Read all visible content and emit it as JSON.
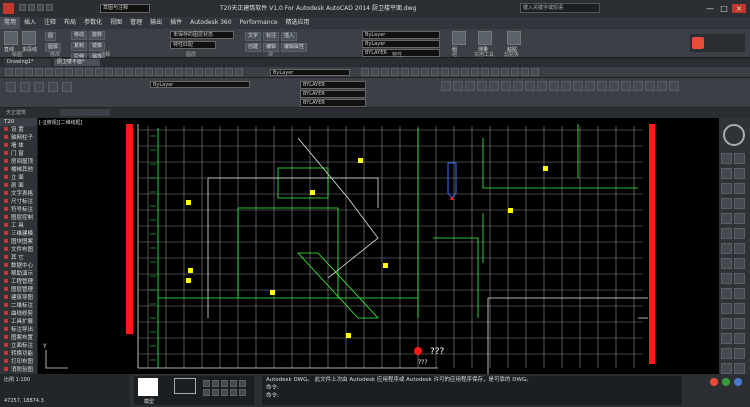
{
  "title": {
    "quick_panel": "草图与注释",
    "window_title": "T20天正建筑软件 V1.0 For Autodesk AutoCAD 2014",
    "file_name": "厨卫楼平面.dwg",
    "search_placeholder": "键入关键字或短语"
  },
  "menu": [
    "常用",
    "插入",
    "注释",
    "布局",
    "参数化",
    "视图",
    "管理",
    "输出",
    "插件",
    "Autodesk 360",
    "Performance",
    "精选应用"
  ],
  "ribbon_groups": [
    "绘图",
    "修改",
    "注释",
    "图层",
    "块",
    "特性",
    "组",
    "实用工具",
    "剪贴板"
  ],
  "ribbon_tools": {
    "line": "直线",
    "polyline": "多段线",
    "circle": "圆",
    "arc": "圆弧",
    "move": "移动",
    "copy": "复制",
    "stretch": "拉伸",
    "rotate": "旋转",
    "mirror": "镜像",
    "scale": "缩放",
    "text": "文字",
    "mark": "标注",
    "insert": "插入",
    "create": "创建",
    "edit": "编辑",
    "edit_attr": "编辑属性",
    "layer_current": "未保存的图层状态",
    "match_attr": "特性匹配",
    "layer_value": "ByLayer",
    "linetype_value": "ByLayer",
    "lineweight_value": "BYLAYER",
    "group": "组",
    "measure": "测量",
    "paste": "粘贴"
  },
  "doc_tabs": [
    "Drawing1*",
    "厨卫楼平面*"
  ],
  "toolbar": {
    "layer_label": "ByLayer",
    "linetype_1": "BYLAYER",
    "linetype_2": "BYLAYER",
    "linetype_3": "BYLAYER",
    "bylayer_right": "ByColor"
  },
  "tianzheng_panel": {
    "header": "T20",
    "subheader": "天正建筑",
    "items": [
      "设  置",
      "轴网柱子",
      "墙  体",
      "门  窗",
      "房间屋顶",
      "楼梯其他",
      "立  面",
      "剖  面",
      "文字表格",
      "尺寸标注",
      "符号标注",
      "图层控制",
      "工  具",
      "三维建模",
      "图块图案",
      "文件布图",
      "其  它",
      "数据中心",
      "帮助演示",
      "工程管理",
      "图层管理",
      "建筑导图",
      "二维标注",
      "曲线修剪",
      "工具扩展",
      "标注导出",
      "图案布置",
      "立面标注",
      "转换功能",
      "打印布图",
      "消防验图",
      "平面辅助",
      "信息提示",
      "帮助说明",
      "备份恢复"
    ]
  },
  "canvas": {
    "viewport_label": "[-][俯视][二维线框]",
    "tag_a": "???",
    "tag_b": "???"
  },
  "command": {
    "line1": "Autodesk DWG。  此文件上次由  Autodesk 应用程序或  Autodesk 许可的应用程序保存，是可靠的 DWG。",
    "prompt": "命令:",
    "prompt2": "命令:",
    "scale_label": "比例 1:100",
    "coords": "47257, 18874.3",
    "status": "模型"
  },
  "colors": {
    "accent_red": "#ff1a1a",
    "grid_line": "#8a8a8a",
    "cad_green": "#3cff3c",
    "cad_yellow": "#ffff00",
    "cad_white": "#e8e8e8"
  }
}
